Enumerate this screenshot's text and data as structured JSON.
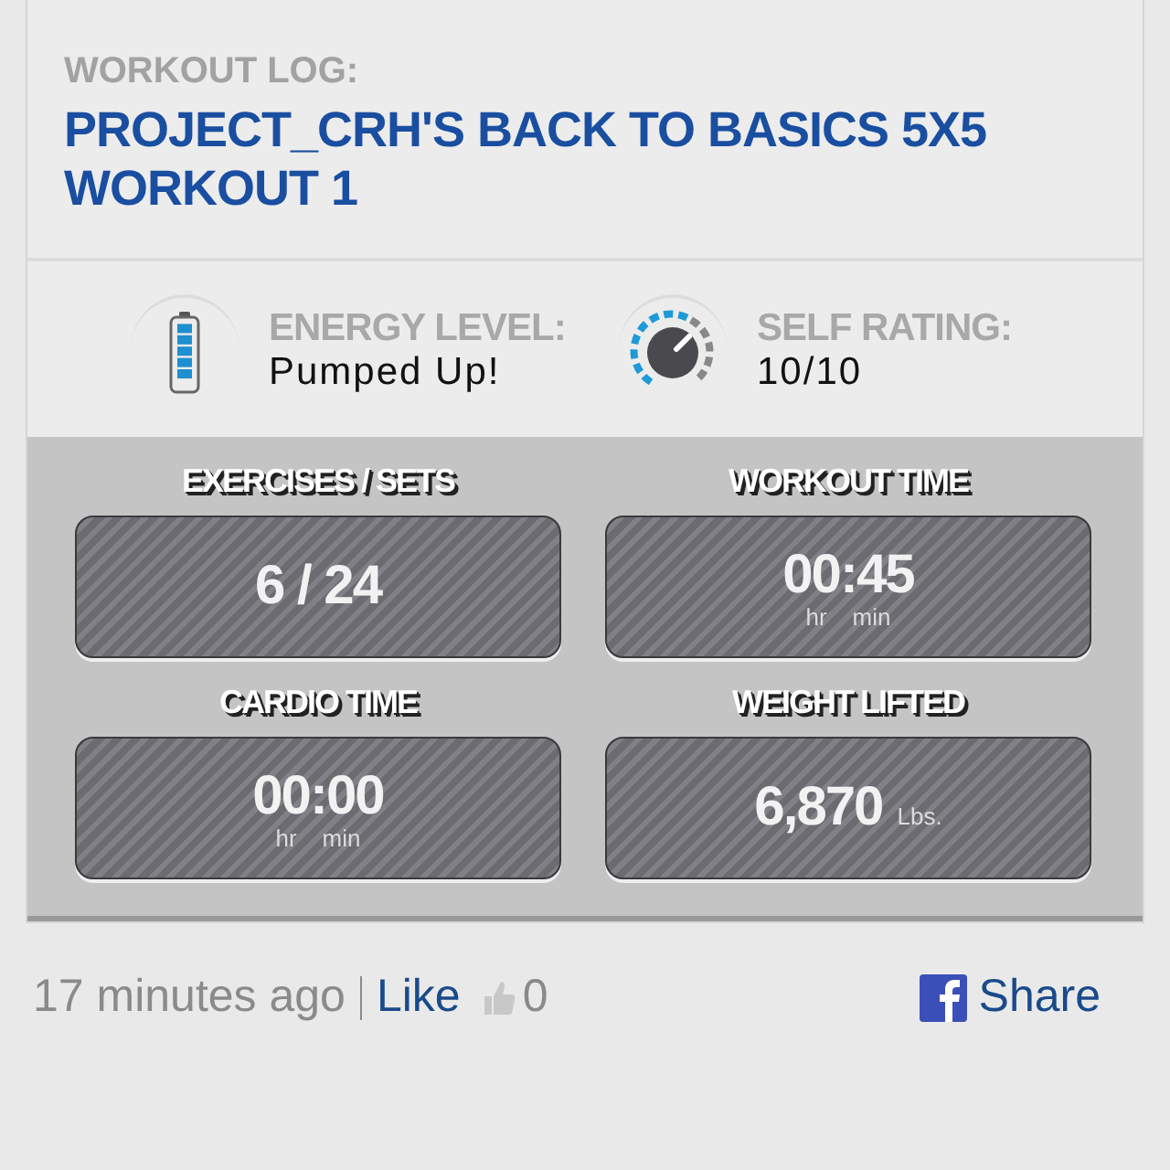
{
  "header": {
    "label": "WORKOUT LOG:",
    "title": "PROJECT_CRH'S BACK TO BASICS 5X5 WORKOUT 1"
  },
  "stats": [
    {
      "kind": "battery",
      "label": "ENERGY LEVEL:",
      "value": "Pumped Up!"
    },
    {
      "kind": "dial",
      "label": "SELF RATING:",
      "value": "10/10"
    }
  ],
  "tiles": [
    {
      "label": "EXERCISES / SETS",
      "value": "6 / 24"
    },
    {
      "label": "WORKOUT TIME",
      "value": "00:45",
      "units": [
        "hr",
        "min"
      ]
    },
    {
      "label": "CARDIO TIME",
      "value": "00:00",
      "units": [
        "hr",
        "min"
      ]
    },
    {
      "label": "WEIGHT LIFTED",
      "value": "6,870",
      "suffix": "Lbs."
    }
  ],
  "footer": {
    "time": "17 minutes ago",
    "like": "Like",
    "like_count": "0",
    "share": "Share"
  }
}
